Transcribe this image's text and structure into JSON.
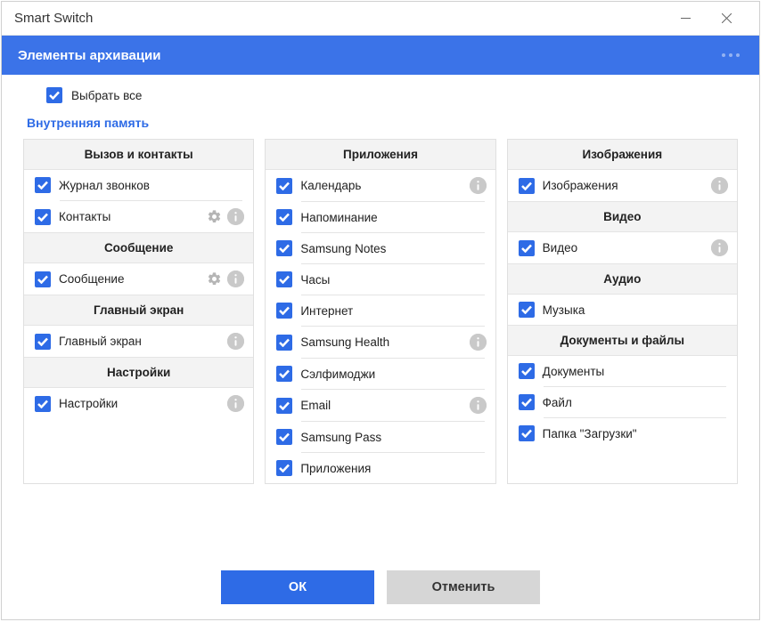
{
  "window": {
    "title": "Smart Switch"
  },
  "header": {
    "title": "Элементы архивации"
  },
  "select_all": {
    "label": "Выбрать все"
  },
  "subtitle": "Внутренняя память",
  "columns": [
    {
      "sections": [
        {
          "title": "Вызов и контакты",
          "items": [
            {
              "label": "Журнал звонков",
              "checked": true
            },
            {
              "label": "Контакты",
              "checked": true,
              "gear": true,
              "info": true
            }
          ]
        },
        {
          "title": "Сообщение",
          "items": [
            {
              "label": "Сообщение",
              "checked": true,
              "gear": true,
              "info": true
            }
          ]
        },
        {
          "title": "Главный экран",
          "items": [
            {
              "label": "Главный экран",
              "checked": true,
              "info": true
            }
          ]
        },
        {
          "title": "Настройки",
          "items": [
            {
              "label": "Настройки",
              "checked": true,
              "info": true
            }
          ]
        }
      ]
    },
    {
      "sections": [
        {
          "title": "Приложения",
          "items": [
            {
              "label": "Календарь",
              "checked": true,
              "info": true
            },
            {
              "label": "Напоминание",
              "checked": true
            },
            {
              "label": "Samsung Notes",
              "checked": true
            },
            {
              "label": "Часы",
              "checked": true
            },
            {
              "label": "Интернет",
              "checked": true
            },
            {
              "label": "Samsung Health",
              "checked": true,
              "info": true
            },
            {
              "label": "Сэлфимоджи",
              "checked": true
            },
            {
              "label": "Email",
              "checked": true,
              "info": true
            },
            {
              "label": "Samsung Pass",
              "checked": true
            },
            {
              "label": "Приложения",
              "checked": true
            }
          ]
        }
      ]
    },
    {
      "sections": [
        {
          "title": "Изображения",
          "items": [
            {
              "label": "Изображения",
              "checked": true,
              "info": true
            }
          ]
        },
        {
          "title": "Видео",
          "items": [
            {
              "label": "Видео",
              "checked": true,
              "info": true
            }
          ]
        },
        {
          "title": "Аудио",
          "items": [
            {
              "label": "Музыка",
              "checked": true
            }
          ]
        },
        {
          "title": "Документы и файлы",
          "items": [
            {
              "label": "Документы",
              "checked": true
            },
            {
              "label": "Файл",
              "checked": true
            },
            {
              "label": "Папка \"Загрузки\"",
              "checked": true
            }
          ]
        }
      ]
    }
  ],
  "footer": {
    "ok": "ОК",
    "cancel": "Отменить"
  }
}
